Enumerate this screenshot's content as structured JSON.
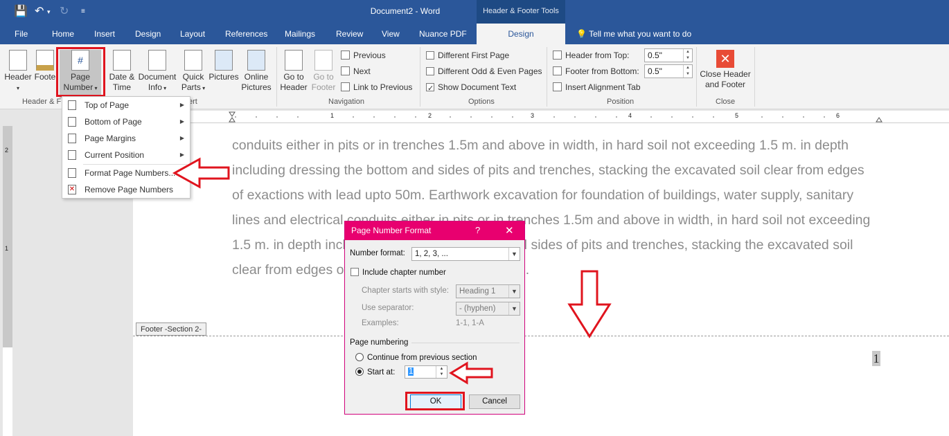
{
  "titlebar": {
    "title": "Document2 - Word",
    "context_title": "Header & Footer Tools",
    "save_icon": "💾",
    "undo_icon": "↶",
    "redo_icon": "↻",
    "customize_icon": "≡"
  },
  "tabs": [
    {
      "label": "File"
    },
    {
      "label": "Home"
    },
    {
      "label": "Insert"
    },
    {
      "label": "Design"
    },
    {
      "label": "Layout"
    },
    {
      "label": "References"
    },
    {
      "label": "Mailings"
    },
    {
      "label": "Review"
    },
    {
      "label": "View"
    },
    {
      "label": "Nuance PDF"
    },
    {
      "label": "Design"
    }
  ],
  "tell_me": "Tell me what you want to do",
  "ribbon": {
    "header": "Header",
    "footer": "Foote",
    "page_number_1": "Page",
    "page_number_2": "Number",
    "date_time_1": "Date &",
    "date_time_2": "Time",
    "doc_info_1": "Document",
    "doc_info_2": "Info",
    "quick_parts_1": "Quick",
    "quick_parts_2": "Parts",
    "pictures": "Pictures",
    "online_pictures_1": "Online",
    "online_pictures_2": "Pictures",
    "goto_header_1": "Go to",
    "goto_header_2": "Header",
    "goto_footer_1": "Go to",
    "goto_footer_2": "Footer",
    "previous": "Previous",
    "next": "Next",
    "link_previous": "Link to Previous",
    "diff_first": "Different First Page",
    "diff_odd_even": "Different Odd & Even Pages",
    "show_doc_text": "Show Document Text",
    "header_from_top": "Header from Top:",
    "header_from_top_val": "0.5\"",
    "footer_from_bottom": "Footer from Bottom:",
    "footer_from_bottom_val": "0.5\"",
    "insert_alignment_tab": "Insert Alignment Tab",
    "close_1": "Close Header",
    "close_2": "and Footer",
    "groups": {
      "header_footer": "Header & F",
      "insert": "ert",
      "navigation": "Navigation",
      "options": "Options",
      "position": "Position",
      "close": "Close"
    }
  },
  "menu": {
    "top_of_page": "Top of Page",
    "bottom_of_page": "Bottom of Page",
    "page_margins": "Page Margins",
    "current_position": "Current Position",
    "format_page_numbers": "Format Page Numbers...",
    "remove_page_numbers": "Remove Page Numbers"
  },
  "ruler": {
    "h_marks": [
      "1",
      "2",
      "3",
      "4",
      "5",
      "6"
    ],
    "v_marks": [
      "2",
      "1"
    ]
  },
  "document": {
    "lines": [
      "conduits either in pits or in trenches 1.5m and above in width, in hard soil  not exceeding 1.5 m. in depth",
      "including dressing the bottom and sides of pits and trenches, stacking the excavated soil clear from edges",
      "of exactions with lead upto 50m. Earthwork excavation for foundation of buildings, water supply, sanitary",
      "lines and electrical conduits either in pits or in trenches 1.5m and above in width, in hard soil  not exceeding",
      "1.5 m. in depth including dressing the bottom and sides of pits and trenches, stacking the excavated soil",
      "clear from edges of exactions with lead upto 50m."
    ],
    "footer_tag": "Footer -Section 2-",
    "page_number": "1"
  },
  "dialog": {
    "title": "Page Number Format",
    "help": "?",
    "close": "✕",
    "number_format_label": "Number format:",
    "number_format_value": "1, 2, 3, ...",
    "include_chapter": "Include chapter number",
    "chapter_style_label": "Chapter starts with style:",
    "chapter_style_value": "Heading 1",
    "separator_label": "Use separator:",
    "separator_value": "-   (hyphen)",
    "examples_label": "Examples:",
    "examples_value": "1-1, 1-A",
    "page_numbering": "Page numbering",
    "continue_prev": "Continue from previous section",
    "start_at": "Start at:",
    "start_at_value": "1",
    "ok": "OK",
    "cancel": "Cancel"
  },
  "colors": {
    "word_blue": "#2b579a",
    "dialog_pink": "#e8006f",
    "annotation_red": "#e0141e"
  }
}
